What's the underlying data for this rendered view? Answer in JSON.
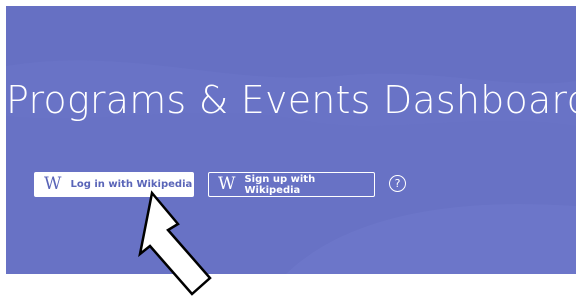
{
  "hero": {
    "title": "Programs & Events Dashboard",
    "background_color": "#6872c5"
  },
  "buttons": {
    "login_label": "Log in with Wikipedia",
    "signup_label": "Sign up with Wikipedia",
    "wikipedia_glyph": "W",
    "help_label": "?"
  },
  "icons": {
    "login": "wikipedia-w-icon",
    "signup": "wikipedia-w-icon",
    "help": "question-mark-icon",
    "pointer": "arrow-annotation-icon"
  }
}
